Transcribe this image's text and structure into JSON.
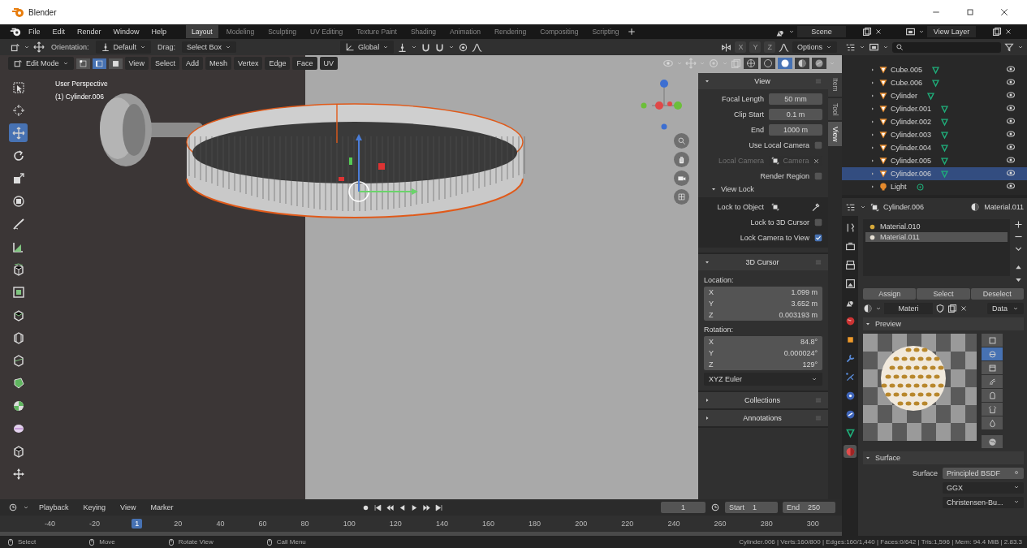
{
  "window": {
    "title": "Blender"
  },
  "menu": [
    "File",
    "Edit",
    "Render",
    "Window",
    "Help"
  ],
  "workspaces": [
    {
      "label": "Layout",
      "selected": true
    },
    {
      "label": "Modeling",
      "selected": false
    },
    {
      "label": "Sculpting",
      "selected": false
    },
    {
      "label": "UV Editing",
      "selected": false
    },
    {
      "label": "Texture Paint",
      "selected": false
    },
    {
      "label": "Shading",
      "selected": false
    },
    {
      "label": "Animation",
      "selected": false
    },
    {
      "label": "Rendering",
      "selected": false
    },
    {
      "label": "Compositing",
      "selected": false
    },
    {
      "label": "Scripting",
      "selected": false
    }
  ],
  "scene": "Scene",
  "view_layer": "View Layer",
  "tool_header": {
    "orientation_label": "Orientation:",
    "pivot": "Default",
    "drag_label": "Drag:",
    "drag": "Select Box",
    "transform_orientation": "Global",
    "axes": [
      {
        "label": "X",
        "on": false
      },
      {
        "label": "Y",
        "on": false
      },
      {
        "label": "Z",
        "on": false
      }
    ],
    "options": "Options"
  },
  "mode_header": {
    "mode": "Edit Mode",
    "select_modes": [
      {
        "selected": false
      },
      {
        "selected": true
      },
      {
        "selected": false
      }
    ],
    "menus": [
      "View",
      "Select",
      "Add",
      "Mesh",
      "Vertex",
      "Edge",
      "Face",
      "UV"
    ],
    "shading": [
      {
        "selected": false
      },
      {
        "selected": false
      },
      {
        "selected": true
      },
      {
        "selected": false
      },
      {
        "selected": false
      }
    ]
  },
  "viewport": {
    "perspective": "User Perspective",
    "object": "(1) Cylinder.006"
  },
  "toolbar": [
    {
      "selected": false
    },
    {
      "selected": false
    },
    {
      "selected": true
    },
    {
      "selected": false
    },
    {
      "selected": false
    },
    {
      "selected": false
    },
    {
      "selected": false
    },
    {
      "selected": false
    },
    {
      "selected": false
    },
    {
      "selected": false
    },
    {
      "selected": false
    },
    {
      "selected": false
    },
    {
      "selected": false
    },
    {
      "selected": false
    },
    {
      "selected": false
    },
    {
      "selected": false
    },
    {
      "selected": false
    },
    {
      "selected": false
    }
  ],
  "sidebar": {
    "tabs": [
      {
        "label": "Item",
        "selected": false
      },
      {
        "label": "Tool",
        "selected": false
      },
      {
        "label": "View",
        "selected": true
      }
    ],
    "panels": [
      {
        "title": "View",
        "expanded": true,
        "rows": [
          {
            "kind": "field",
            "label": "Focal Length",
            "value": "50 mm"
          },
          {
            "kind": "field",
            "label": "Clip Start",
            "value": "0.1 m"
          },
          {
            "kind": "field",
            "label": "End",
            "value": "1000 m"
          },
          {
            "kind": "check",
            "label": "Use Local Camera",
            "checked": false
          },
          {
            "kind": "object",
            "label": "Local Camera",
            "value": "Camera",
            "disabled": true
          },
          {
            "kind": "check",
            "label": "Render Region",
            "checked": false
          },
          {
            "kind": "subpanel",
            "label": "View Lock",
            "expanded": true,
            "rows": [
              {
                "kind": "object",
                "label": "Lock to Object",
                "disabled": false
              },
              {
                "kind": "check",
                "label": "Lock to 3D Cursor",
                "checked": false
              },
              {
                "kind": "check",
                "label": "Lock Camera to View",
                "checked": true
              }
            ]
          }
        ]
      },
      {
        "title": "3D Cursor",
        "expanded": true,
        "rows": [
          {
            "kind": "heading",
            "label": "Location:"
          },
          {
            "kind": "vector",
            "items": [
              {
                "axis": "X",
                "value": "1.099 m"
              },
              {
                "axis": "Y",
                "value": "3.652 m"
              },
              {
                "axis": "Z",
                "value": "0.003193 m"
              }
            ]
          },
          {
            "kind": "heading",
            "label": "Rotation:"
          },
          {
            "kind": "vector",
            "items": [
              {
                "axis": "X",
                "value": "84.8°"
              },
              {
                "axis": "Y",
                "value": "0.000024°"
              },
              {
                "axis": "Z",
                "value": "129°"
              }
            ]
          },
          {
            "kind": "dropdown",
            "value": "XYZ Euler"
          }
        ]
      },
      {
        "title": "Collections",
        "expanded": false
      },
      {
        "title": "Annotations",
        "expanded": false
      }
    ]
  },
  "outliner": [
    {
      "name": "Cube.005",
      "kind": "mesh",
      "selected": false
    },
    {
      "name": "Cube.006",
      "kind": "mesh",
      "selected": false
    },
    {
      "name": "Cylinder",
      "kind": "mesh",
      "selected": false
    },
    {
      "name": "Cylinder.001",
      "kind": "mesh",
      "selected": false
    },
    {
      "name": "Cylinder.002",
      "kind": "mesh",
      "selected": false
    },
    {
      "name": "Cylinder.003",
      "kind": "mesh",
      "selected": false
    },
    {
      "name": "Cylinder.004",
      "kind": "mesh",
      "selected": false
    },
    {
      "name": "Cylinder.005",
      "kind": "mesh",
      "selected": false
    },
    {
      "name": "Cylinder.006",
      "kind": "mesh",
      "selected": true
    },
    {
      "name": "Light",
      "kind": "light",
      "selected": false
    }
  ],
  "properties": {
    "object": "Cylinder.006",
    "material": "Material.011",
    "tabs": [
      {
        "selected": false
      },
      {
        "selected": false
      },
      {
        "selected": false
      },
      {
        "selected": false
      },
      {
        "selected": false
      },
      {
        "selected": false
      },
      {
        "selected": false
      },
      {
        "selected": false
      },
      {
        "selected": false
      },
      {
        "selected": false
      },
      {
        "selected": false
      },
      {
        "selected": false
      },
      {
        "selected": true
      }
    ],
    "slots": [
      {
        "name": "Material.010",
        "selected": false
      },
      {
        "name": "Material.011",
        "selected": true
      }
    ],
    "slot_buttons": [
      "Assign",
      "Select",
      "Deselect"
    ],
    "material_name": "Materi",
    "link": "Data",
    "preview_title": "Preview",
    "preview_shapes": [
      {
        "selected": false
      },
      {
        "selected": true
      },
      {
        "selected": false
      },
      {
        "selected": false
      },
      {
        "selected": false
      },
      {
        "selected": false
      },
      {
        "selected": false
      }
    ],
    "surface_title": "Surface",
    "surface_label": "Surface",
    "surface_shader": "Principled BSDF",
    "distribution": "GGX",
    "subsurface": "Christensen-Bu..."
  },
  "timeline": {
    "menus": [
      "Playback",
      "Keying",
      "View",
      "Marker"
    ],
    "current_frame": "1",
    "start_label": "Start",
    "start": "1",
    "end_label": "End",
    "end": "250",
    "ruler": [
      {
        "label": "-40",
        "selected": false
      },
      {
        "label": "-20",
        "selected": false
      },
      {
        "label": "1",
        "selected": true
      },
      {
        "label": "20",
        "selected": false
      },
      {
        "label": "40",
        "selected": false
      },
      {
        "label": "60",
        "selected": false
      },
      {
        "label": "80",
        "selected": false
      },
      {
        "label": "100",
        "selected": false
      },
      {
        "label": "120",
        "selected": false
      },
      {
        "label": "140",
        "selected": false
      },
      {
        "label": "160",
        "selected": false
      },
      {
        "label": "180",
        "selected": false
      },
      {
        "label": "200",
        "selected": false
      },
      {
        "label": "220",
        "selected": false
      },
      {
        "label": "240",
        "selected": false
      },
      {
        "label": "260",
        "selected": false
      },
      {
        "label": "280",
        "selected": false
      },
      {
        "label": "300",
        "selected": false
      }
    ]
  },
  "status_bar": {
    "hints": [
      "Select",
      "Move",
      "Rotate View",
      "Call Menu"
    ],
    "stats": "Cylinder.006 | Verts:160/800 | Edges:160/1,440 | Faces:0/642 | Tris:1,596 | Mem: 94.4 MiB | 2.83.3"
  }
}
